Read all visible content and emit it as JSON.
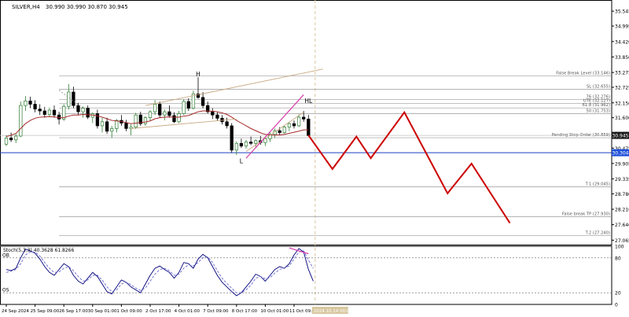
{
  "chart_data": [
    {
      "type": "candlestick",
      "symbol_header": "SILVER,H4",
      "ohlc_readout": "30.990 30.990 30.870 30.945",
      "time_axis": [
        "24 Sep 2024",
        "25 Sep 09:00",
        "26 Sep 17:00",
        "30 Sep 01:00",
        "1 Oct 09:00",
        "2 Oct 17:00",
        "4 Oct 01:00",
        "7 Oct 09:00",
        "8 Oct 17:00",
        "10 Oct 01:00",
        "11 Oct 09:00"
      ],
      "future_time_label": "2024.10.14 00:00",
      "price_ticks": [
        "35.545",
        "34.995",
        "34.420",
        "33.850",
        "33.275",
        "32.725",
        "32.150",
        "31.600",
        "31.025",
        "30.475",
        "29.905",
        "29.335",
        "28.780",
        "28.210",
        "27.640",
        "27.065"
      ],
      "ylim": [
        26.9,
        35.9
      ],
      "current_price": "30.945",
      "horizontal_line_price": "30.304",
      "levels": [
        {
          "label": "False Break Level (33.146)",
          "price": 33.146
        },
        {
          "label": "SL (32.655)",
          "price": 32.655
        },
        {
          "label": "76 (32.276)",
          "price": 32.276
        },
        {
          "label": "UTE (32.127)",
          "price": 32.127
        },
        {
          "label": "61.8 (31.962)",
          "price": 31.962
        },
        {
          "label": "50 (31.753)",
          "price": 31.753
        },
        {
          "label": "Pending Stop Order (30.859)",
          "price": 30.859
        },
        {
          "label": "T.1 (29.045)",
          "price": 29.045
        },
        {
          "label": "False break TP (27.930)",
          "price": 27.93
        },
        {
          "label": "T.2 (27.240)",
          "price": 27.24
        }
      ],
      "annotations": [
        "H",
        "HL",
        "L"
      ],
      "candles": [
        [
          30.62,
          30.95,
          30.55,
          30.85
        ],
        [
          30.85,
          31.05,
          30.7,
          30.78
        ],
        [
          30.78,
          31.0,
          30.66,
          30.92
        ],
        [
          30.92,
          32.2,
          30.88,
          32.05
        ],
        [
          32.05,
          32.4,
          31.85,
          32.22
        ],
        [
          32.22,
          32.38,
          31.95,
          32.1
        ],
        [
          32.1,
          32.25,
          31.8,
          31.92
        ],
        [
          31.92,
          32.1,
          31.7,
          31.85
        ],
        [
          31.85,
          32.0,
          31.6,
          31.72
        ],
        [
          31.72,
          31.98,
          31.62,
          31.88
        ],
        [
          31.88,
          32.05,
          31.6,
          31.7
        ],
        [
          31.7,
          31.82,
          31.35,
          31.55
        ],
        [
          31.55,
          32.1,
          31.48,
          32.02
        ],
        [
          32.02,
          32.85,
          31.9,
          32.55
        ],
        [
          32.55,
          32.75,
          31.95,
          32.05
        ],
        [
          32.05,
          32.15,
          31.7,
          31.82
        ],
        [
          31.82,
          32.02,
          31.6,
          31.95
        ],
        [
          31.95,
          32.05,
          31.55,
          31.62
        ],
        [
          31.62,
          31.8,
          31.4,
          31.75
        ],
        [
          31.75,
          31.9,
          31.2,
          31.3
        ],
        [
          31.3,
          31.6,
          31.05,
          31.45
        ],
        [
          31.45,
          31.6,
          31.0,
          31.1
        ],
        [
          31.1,
          31.3,
          30.85,
          31.2
        ],
        [
          31.2,
          31.55,
          31.05,
          31.5
        ],
        [
          31.5,
          31.7,
          31.3,
          31.4
        ],
        [
          31.4,
          31.52,
          31.1,
          31.2
        ],
        [
          31.2,
          31.35,
          30.95,
          31.25
        ],
        [
          31.25,
          31.78,
          31.18,
          31.7
        ],
        [
          31.7,
          31.82,
          31.3,
          31.38
        ],
        [
          31.38,
          31.65,
          31.3,
          31.6
        ],
        [
          31.6,
          31.88,
          31.5,
          31.82
        ],
        [
          31.82,
          32.25,
          31.7,
          32.1
        ],
        [
          32.1,
          32.2,
          31.6,
          31.7
        ],
        [
          31.7,
          31.9,
          31.5,
          31.82
        ],
        [
          31.82,
          32.05,
          31.6,
          31.68
        ],
        [
          31.68,
          31.8,
          31.4,
          31.45
        ],
        [
          31.45,
          31.85,
          31.4,
          31.75
        ],
        [
          31.75,
          32.28,
          31.7,
          32.2
        ],
        [
          32.2,
          32.32,
          31.85,
          31.95
        ],
        [
          31.95,
          32.6,
          31.9,
          32.48
        ],
        [
          32.48,
          33.1,
          32.3,
          32.35
        ],
        [
          32.35,
          32.55,
          31.95,
          32.05
        ],
        [
          32.05,
          32.2,
          31.75,
          31.82
        ],
        [
          31.82,
          31.95,
          31.55,
          31.7
        ],
        [
          31.7,
          31.8,
          31.5,
          31.58
        ],
        [
          31.58,
          31.7,
          31.35,
          31.45
        ],
        [
          31.45,
          31.6,
          31.2,
          31.3
        ],
        [
          31.3,
          31.4,
          30.3,
          30.4
        ],
        [
          30.4,
          30.72,
          30.22,
          30.65
        ],
        [
          30.65,
          30.82,
          30.48,
          30.55
        ],
        [
          30.55,
          30.78,
          30.45,
          30.7
        ],
        [
          30.7,
          30.9,
          30.58,
          30.65
        ],
        [
          30.65,
          30.8,
          30.52,
          30.75
        ],
        [
          30.75,
          30.92,
          30.6,
          30.68
        ],
        [
          30.68,
          30.88,
          30.55,
          30.82
        ],
        [
          30.82,
          31.05,
          30.7,
          30.98
        ],
        [
          30.98,
          31.2,
          30.85,
          31.12
        ],
        [
          31.12,
          31.25,
          30.95,
          31.05
        ],
        [
          31.05,
          31.32,
          31.0,
          31.25
        ],
        [
          31.25,
          31.45,
          31.1,
          31.38
        ],
        [
          31.38,
          31.5,
          31.2,
          31.3
        ],
        [
          31.3,
          31.72,
          31.25,
          31.62
        ],
        [
          31.62,
          31.85,
          31.45,
          31.55
        ],
        [
          31.55,
          31.7,
          30.9,
          30.94
        ]
      ],
      "moving_average": [
        30.9,
        30.95,
        31.02,
        31.2,
        31.38,
        31.5,
        31.58,
        31.62,
        31.63,
        31.64,
        31.63,
        31.6,
        31.6,
        31.66,
        31.7,
        31.7,
        31.72,
        31.71,
        31.7,
        31.67,
        31.62,
        31.56,
        31.5,
        31.48,
        31.46,
        31.42,
        31.38,
        31.4,
        31.42,
        31.44,
        31.48,
        31.56,
        31.6,
        31.62,
        31.63,
        31.62,
        31.62,
        31.66,
        31.68,
        31.75,
        31.82,
        31.85,
        31.85,
        31.84,
        31.82,
        31.78,
        31.72,
        31.62,
        31.5,
        31.4,
        31.3,
        31.2,
        31.12,
        31.04,
        30.98,
        30.96,
        30.96,
        30.96,
        30.98,
        31.02,
        31.06,
        31.1,
        31.15,
        31.15
      ],
      "projection_path": [
        [
          30.95,
          0
        ],
        [
          29.7,
          5
        ],
        [
          30.9,
          10
        ],
        [
          30.1,
          13
        ],
        [
          31.8,
          20
        ],
        [
          28.8,
          29
        ],
        [
          29.9,
          34
        ],
        [
          27.7,
          42
        ]
      ],
      "trendlines": [
        {
          "from": [
            32.05,
            29
          ],
          "to": [
            33.4,
            66
          ]
        },
        {
          "from": [
            31.2,
            26
          ],
          "to": [
            31.55,
            48
          ]
        },
        {
          "from": [
            30.35,
            50
          ],
          "to": [
            31.8,
            62
          ]
        },
        {
          "from": [
            30.1,
            50
          ],
          "to": [
            32.45,
            62
          ]
        }
      ],
      "colors": {
        "bull": "#2e7d32",
        "bear": "#000000",
        "ma": "#a52a2a",
        "projection": "#cc0000",
        "trend": "#c8a882",
        "pink": "#d63aa8",
        "current_price_box": "#1a1a1a",
        "hline_box": "#1f4fd8"
      }
    },
    {
      "type": "line",
      "indicator_header": "Stoch(5,3,3) 40.3628 61.8266",
      "ylim": [
        0,
        100
      ],
      "ticks": [
        "100",
        "80",
        "20",
        "0"
      ],
      "levels": [
        {
          "label": "OB",
          "value": 80
        },
        {
          "label": "OS",
          "value": 20
        }
      ],
      "series": [
        {
          "values": [
            60,
            58,
            62,
            80,
            95,
            92,
            88,
            78,
            65,
            55,
            50,
            60,
            70,
            65,
            50,
            40,
            35,
            45,
            55,
            48,
            35,
            22,
            18,
            30,
            42,
            38,
            30,
            25,
            20,
            35,
            50,
            62,
            66,
            60,
            55,
            45,
            55,
            72,
            70,
            62,
            78,
            86,
            80,
            65,
            50,
            38,
            30,
            22,
            15,
            20,
            30,
            40,
            52,
            48,
            40,
            50,
            60,
            65,
            62,
            70,
            85,
            96,
            90,
            60,
            40
          ]
        },
        {
          "values": [
            55,
            57,
            60,
            70,
            85,
            90,
            90,
            83,
            72,
            62,
            55,
            56,
            62,
            65,
            58,
            48,
            40,
            42,
            50,
            50,
            42,
            30,
            22,
            25,
            35,
            38,
            34,
            28,
            24,
            28,
            40,
            52,
            60,
            62,
            58,
            50,
            52,
            62,
            68,
            66,
            72,
            80,
            82,
            72,
            58,
            45,
            36,
            28,
            20,
            20,
            25,
            33,
            45,
            48,
            44,
            46,
            54,
            60,
            63,
            66,
            78,
            90,
            92,
            76,
            62
          ]
        }
      ],
      "colors": {
        "main": "#00007a",
        "signal": "#6666cc",
        "pink": "#d63aa8"
      }
    }
  ]
}
